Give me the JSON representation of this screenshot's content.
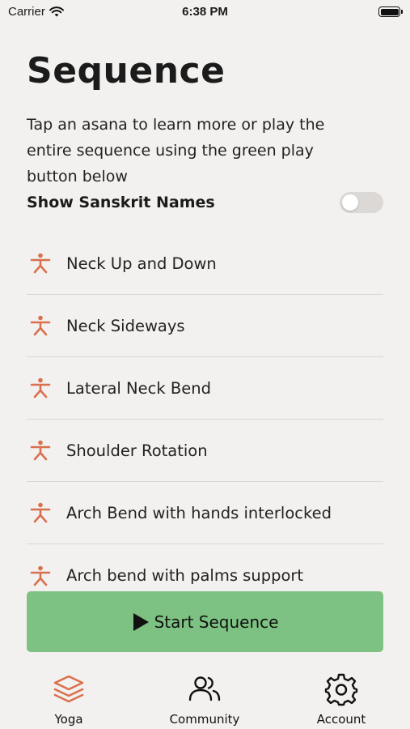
{
  "status_bar": {
    "carrier": "Carrier",
    "time": "6:38 PM"
  },
  "page": {
    "title": "Sequence",
    "description": "Tap an asana to learn more or play the entire sequence using the green play button below",
    "sanskrit_toggle_label": "Show Sanskrit Names",
    "sanskrit_toggle_on": false
  },
  "asanas": [
    {
      "label": "Neck Up and Down",
      "icon": "yoga-pose-icon"
    },
    {
      "label": "Neck Sideways",
      "icon": "yoga-pose-icon"
    },
    {
      "label": "Lateral Neck Bend",
      "icon": "yoga-pose-icon"
    },
    {
      "label": "Shoulder Rotation",
      "icon": "yoga-pose-icon"
    },
    {
      "label": "Arch Bend with hands interlocked",
      "icon": "yoga-pose-icon"
    },
    {
      "label": "Arch bend with palms support",
      "icon": "yoga-pose-icon"
    }
  ],
  "start_button": {
    "label": "Start Sequence",
    "icon": "play-icon"
  },
  "tabs": [
    {
      "label": "Yoga",
      "icon": "layers-icon",
      "active": true
    },
    {
      "label": "Community",
      "icon": "users-icon",
      "active": false
    },
    {
      "label": "Account",
      "icon": "gear-icon",
      "active": false
    }
  ],
  "colors": {
    "background": "#f3f1ef",
    "accent": "#d9704e",
    "play_button": "#7dc282",
    "toggle_off": "#dcd8d6"
  }
}
